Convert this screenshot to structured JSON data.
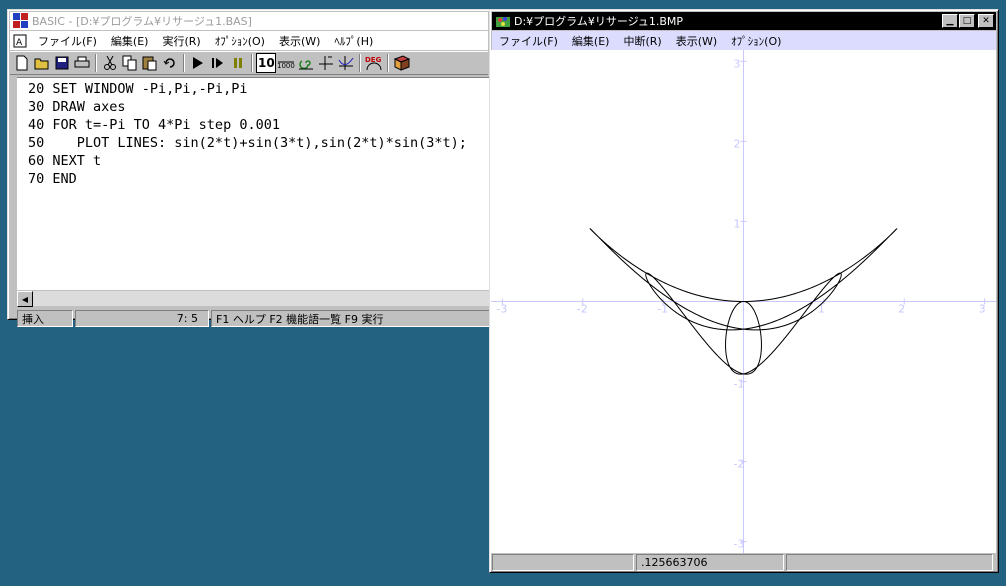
{
  "editor_window": {
    "title": "BASIC - [D:¥プログラム¥リサージュ1.BAS]",
    "menu": [
      "ファイル(F)",
      "編集(E)",
      "実行(R)",
      "ｵﾌﾟｼｮﾝ(O)",
      "表示(W)",
      "ﾍﾙﾌﾟ(H)"
    ],
    "toolbar_icons": [
      "new-file-icon",
      "open-folder-icon",
      "save-icon",
      "print-icon",
      "cut-icon",
      "copy-icon",
      "paste-icon",
      "undo-icon",
      "run-icon",
      "step-icon",
      "pause-icon",
      "line-number-icon",
      "decimal-icon",
      "spiral-icon",
      "axes-icon",
      "graph-icon",
      "degree-icon",
      "book-icon"
    ],
    "toolbar_labels": {
      "line_number": "10",
      "decimal": "1000",
      "degree": "DEG"
    },
    "code_lines": [
      "20 SET WINDOW -Pi,Pi,-Pi,Pi",
      "30 DRAW axes",
      "40 FOR t=-Pi TO 4*Pi step 0.001",
      "50    PLOT LINES: sin(2*t)+sin(3*t),sin(2*t)*sin(3*t);",
      "60 NEXT t",
      "70 END"
    ],
    "status": {
      "mode": "挿入",
      "cursor": "7:  5",
      "hints": "F1 ヘルプ  F2 機能語一覧  F9 実行"
    }
  },
  "graph_window": {
    "title": "D:¥プログラム¥リサージュ1.BMP",
    "menu": [
      "ファイル(F)",
      "編集(E)",
      "中断(R)",
      "表示(W)",
      "ｵﾌﾟｼｮﾝ(O)"
    ],
    "status_value": ".125663706"
  },
  "chart_data": {
    "type": "line",
    "title": "",
    "xlabel": "",
    "ylabel": "",
    "xlim": [
      -3.14159,
      3.14159
    ],
    "ylim": [
      -3.14159,
      3.14159
    ],
    "x_ticks": [
      -3,
      -2,
      -1,
      1,
      2,
      3
    ],
    "y_ticks": [
      -3,
      -2,
      -1,
      1,
      2,
      3
    ],
    "x_tick_labels": [
      "-3",
      "-2",
      "-1",
      "1",
      "2",
      "3"
    ],
    "y_tick_labels": [
      "-3",
      "-2",
      "-1",
      "1",
      "2",
      "3"
    ],
    "curve": {
      "x_expr": "sin(2*t)+sin(3*t)",
      "y_expr": "sin(2*t)*sin(3*t)",
      "t_range": [
        -3.14159,
        12.56637
      ],
      "t_step": 0.001
    },
    "axis_color": "#c8c8ff",
    "line_color": "#000000"
  }
}
